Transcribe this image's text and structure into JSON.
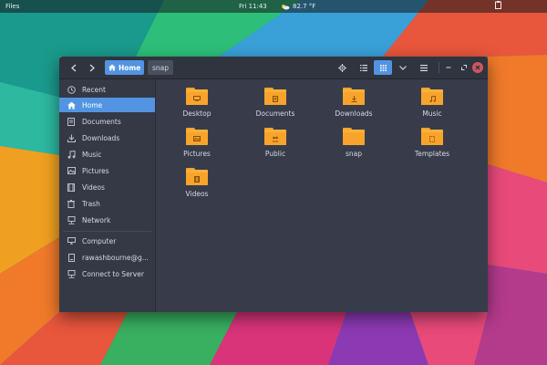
{
  "topbar": {
    "app_name": "Files",
    "clock": "Fri 11:43",
    "weather": "82.7 °F",
    "weather_icon": "cloud-sun-icon"
  },
  "window": {
    "path": {
      "home_label": "Home",
      "child_label": "snap"
    },
    "toolbar_icons": [
      "back-icon",
      "forward-icon",
      "locate-icon",
      "list-view-icon",
      "grid-view-icon",
      "view-options-icon",
      "menu-icon",
      "minimize-icon",
      "maximize-icon",
      "close-icon"
    ]
  },
  "sidebar": {
    "items": [
      {
        "label": "Recent",
        "icon": "clock-icon"
      },
      {
        "label": "Home",
        "icon": "home-icon",
        "active": true
      },
      {
        "label": "Documents",
        "icon": "document-icon"
      },
      {
        "label": "Downloads",
        "icon": "download-icon"
      },
      {
        "label": "Music",
        "icon": "music-icon"
      },
      {
        "label": "Pictures",
        "icon": "picture-icon"
      },
      {
        "label": "Videos",
        "icon": "video-icon"
      },
      {
        "label": "Trash",
        "icon": "trash-icon"
      },
      {
        "label": "Network",
        "icon": "network-icon"
      },
      {
        "label": "Computer",
        "icon": "computer-icon"
      },
      {
        "label": "rawashbourne@g...",
        "icon": "drive-icon"
      },
      {
        "label": "Connect to Server",
        "icon": "server-icon"
      }
    ]
  },
  "content": {
    "folders": [
      {
        "label": "Desktop",
        "icon": "desktop-folder-icon"
      },
      {
        "label": "Documents",
        "icon": "documents-folder-icon"
      },
      {
        "label": "Downloads",
        "icon": "downloads-folder-icon"
      },
      {
        "label": "Music",
        "icon": "music-folder-icon"
      },
      {
        "label": "Pictures",
        "icon": "pictures-folder-icon"
      },
      {
        "label": "Public",
        "icon": "public-folder-icon"
      },
      {
        "label": "snap",
        "icon": "folder-icon"
      },
      {
        "label": "Templates",
        "icon": "templates-folder-icon"
      },
      {
        "label": "Videos",
        "icon": "videos-folder-icon"
      }
    ]
  },
  "colors": {
    "accent": "#5294e2",
    "folder": "#fbb13a",
    "close": "#cc575d"
  }
}
